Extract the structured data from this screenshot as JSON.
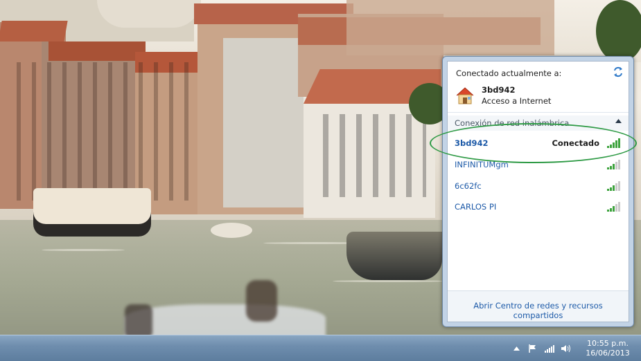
{
  "popup": {
    "header": "Conectado actualmente a:",
    "current": {
      "name": "3bd942",
      "status": "Acceso a Internet"
    },
    "group_label": "Conexión de red inalámbrica",
    "networks": [
      {
        "name": "3bd942",
        "status": "Conectado"
      },
      {
        "name": "INFINITUMgm",
        "status": ""
      },
      {
        "name": "6c62fc",
        "status": ""
      },
      {
        "name": "CARLOS PI",
        "status": ""
      }
    ],
    "footer_link": "Abrir Centro de redes y recursos compartidos"
  },
  "taskbar": {
    "time": "10:55 p.m.",
    "date": "16/06/2013",
    "icons": [
      "show-hidden-icons-icon",
      "action-center-flag-icon",
      "network-signal-icon",
      "volume-icon"
    ]
  },
  "colors": {
    "link": "#1d5aa8",
    "highlight": "#2e9a45"
  }
}
